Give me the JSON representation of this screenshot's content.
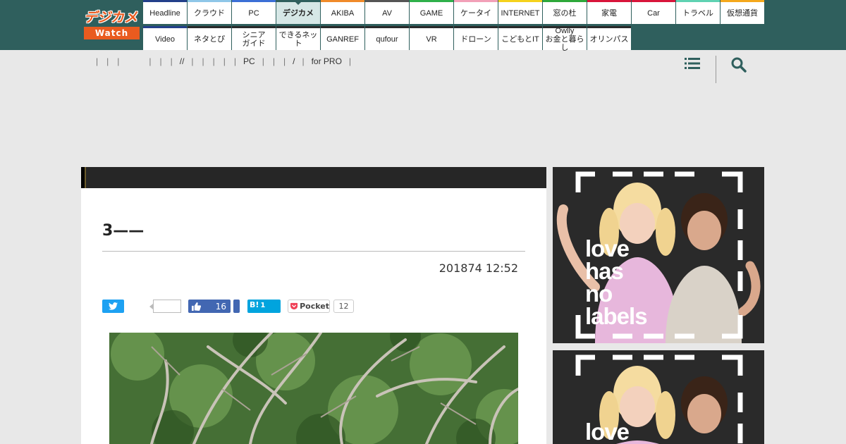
{
  "logo": {
    "top": "デジカメ",
    "bottom": "Watch"
  },
  "nav": {
    "row1": [
      {
        "label": "Headline",
        "color": "#233f8a"
      },
      {
        "label": "クラウド",
        "color": "#8fc7e8"
      },
      {
        "label": "PC",
        "color": "#3b6fd6"
      },
      {
        "label": "デジカメ",
        "color": "#2f5f5d",
        "active": true
      },
      {
        "label": "AKIBA",
        "color": "#f08a2a"
      },
      {
        "label": "AV",
        "color": "#555555"
      },
      {
        "label": "GAME",
        "color": "#2fb04a"
      },
      {
        "label": "ケータイ",
        "color": "#f2a0b8"
      },
      {
        "label": "INTERNET",
        "color": "#f5d21c"
      },
      {
        "label": "窓の杜",
        "color": "#2ea83a"
      },
      {
        "label": "家電",
        "color": "#d8153a"
      },
      {
        "label": "Car",
        "color": "#d8153a"
      },
      {
        "label": "トラベル",
        "color": "#5fd2b2"
      },
      {
        "label": "仮想通貨",
        "color": "#f5a81c"
      }
    ],
    "row2": [
      {
        "label": "Video",
        "color": "#233f8a"
      },
      {
        "label": "ネタとぴ",
        "color": "#2a2a2a"
      },
      {
        "label": "シニア\nガイド",
        "color": "#2a2a2a"
      },
      {
        "label": "できるネット",
        "color": "#2a2a2a"
      },
      {
        "label": "GANREF",
        "color": "#2a2a2a"
      },
      {
        "label": "qufour",
        "color": "#2a2a2a"
      },
      {
        "label": "VR",
        "color": "#2a2a2a"
      },
      {
        "label": "ドローン",
        "color": "#2a2a2a"
      },
      {
        "label": "こどもとIT",
        "color": "#2a2a2a"
      },
      {
        "label": "Owlly\nお金と暮らし",
        "color": "#2a2a2a"
      },
      {
        "label": "オリンパス",
        "color": "#2a2a2a"
      }
    ]
  },
  "subnav": [
    {
      "type": "sep"
    },
    {
      "type": "sep"
    },
    {
      "type": "sep"
    },
    {
      "type": "gap"
    },
    {
      "type": "sep"
    },
    {
      "type": "sep"
    },
    {
      "type": "sep"
    },
    {
      "type": "item",
      "label": "//"
    },
    {
      "type": "sep"
    },
    {
      "type": "sep"
    },
    {
      "type": "sep"
    },
    {
      "type": "sep"
    },
    {
      "type": "sep"
    },
    {
      "type": "item",
      "label": "PC"
    },
    {
      "type": "sep"
    },
    {
      "type": "sep"
    },
    {
      "type": "sep"
    },
    {
      "type": "item",
      "label": "/"
    },
    {
      "type": "sep"
    },
    {
      "type": "item",
      "label": "for PRO"
    },
    {
      "type": "sep"
    }
  ],
  "article": {
    "title": "3——",
    "date": "201874 12:52"
  },
  "share": {
    "facebook_count": "16",
    "hatena_label": "B!",
    "hatena_count": "1",
    "pocket_label": "Pocket",
    "pocket_count": "12"
  },
  "ads": {
    "text_lines": [
      "love",
      "has",
      "no",
      "labels"
    ]
  }
}
